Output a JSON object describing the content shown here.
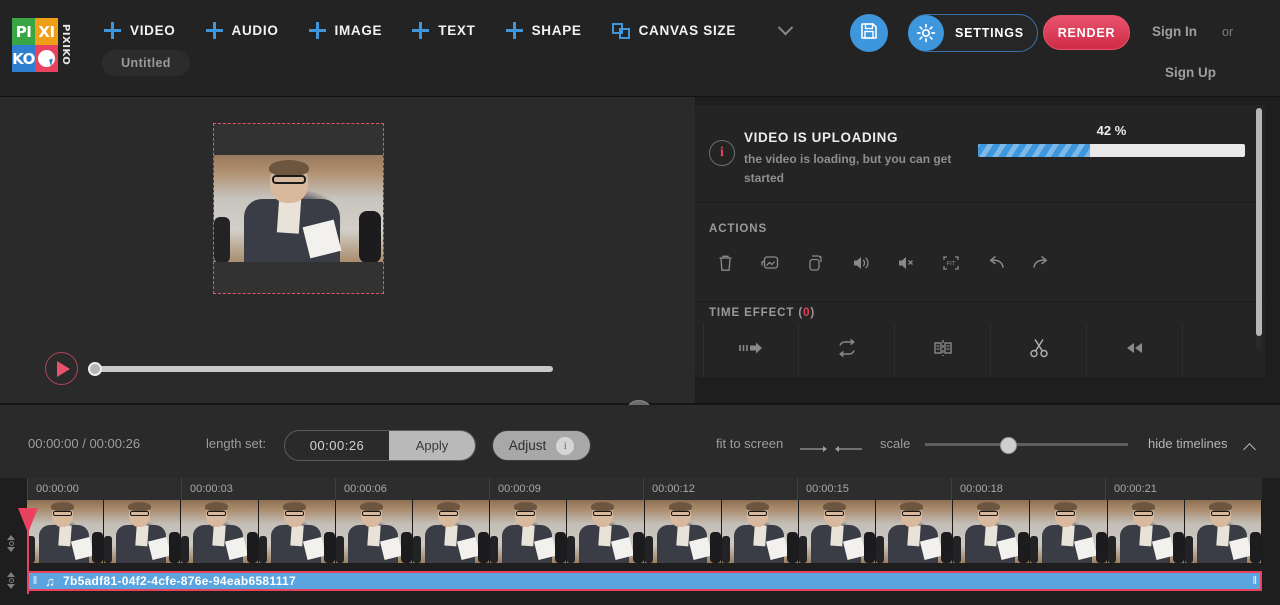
{
  "header": {
    "logo": {
      "cells": [
        "PI",
        "XI",
        "KO",
        ""
      ],
      "vertical_text": "PIXIKO",
      "colors": {
        "pi": "#3aa545",
        "xi": "#f0a018",
        "ko": "#2f7fd0",
        "dot": "#e8425f"
      }
    },
    "menu": [
      {
        "label": "VIDEO",
        "icon": "plus-icon"
      },
      {
        "label": "AUDIO",
        "icon": "plus-icon"
      },
      {
        "label": "IMAGE",
        "icon": "plus-icon"
      },
      {
        "label": "TEXT",
        "icon": "plus-icon"
      },
      {
        "label": "SHAPE",
        "icon": "plus-icon"
      },
      {
        "label": "CANVAS SIZE",
        "icon": "canvas-size-icon"
      }
    ],
    "project_name": "Untitled",
    "save_icon": "floppy-disk-icon",
    "settings_label": "SETTINGS",
    "settings_icon": "gear-icon",
    "render_label": "RENDER",
    "sign_in": "Sign In",
    "or": "or",
    "sign_up": "Sign Up",
    "accent_blue": "#3e96dd",
    "accent_red": "#e8425f"
  },
  "preview": {
    "play_icon": "play-icon",
    "seek_position_pct": 0
  },
  "panel": {
    "upload": {
      "title": "VIDEO IS UPLOADING",
      "subtitle": "the video is loading, but you can get started",
      "percent_label": "42 %",
      "percent_value": 42,
      "info_icon": "info-icon"
    },
    "actions": {
      "title": "ACTIONS",
      "items": [
        {
          "icon": "trash-icon",
          "name": "delete"
        },
        {
          "icon": "image-frame-icon",
          "name": "background"
        },
        {
          "icon": "duplicate-icon",
          "name": "duplicate"
        },
        {
          "icon": "volume-up-icon",
          "name": "volume-up"
        },
        {
          "icon": "volume-mute-icon",
          "name": "mute"
        },
        {
          "icon": "fit-icon",
          "name": "fit"
        },
        {
          "icon": "undo-icon",
          "name": "undo"
        },
        {
          "icon": "redo-icon",
          "name": "redo"
        }
      ]
    },
    "time_effect": {
      "title": "TIME EFFECT (",
      "count": "0",
      "title_end": ")",
      "items": [
        {
          "icon": "speed-icon",
          "name": "speed"
        },
        {
          "icon": "loop-icon",
          "name": "loop"
        },
        {
          "icon": "mirror-icon",
          "name": "mirror"
        },
        {
          "icon": "scissors-icon",
          "name": "cut"
        },
        {
          "icon": "rewind-icon",
          "name": "reverse"
        }
      ]
    }
  },
  "timeline_controls": {
    "timecode": "00:00:00 / 00:00:26",
    "length_set_label": "length set:",
    "length_value": "00:00:26",
    "apply_label": "Apply",
    "adjust_label": "Adjust",
    "adjust_info": "i",
    "fit_to_screen": "fit to screen",
    "scale_label": "scale",
    "scale_value": 41,
    "hide_timelines": "hide timelines"
  },
  "timeline": {
    "ruler_ticks": [
      "00:00:00",
      "00:00:03",
      "00:00:06",
      "00:00:09",
      "00:00:12",
      "00:00:15",
      "00:00:18",
      "00:00:21"
    ],
    "video_frame_count": 16,
    "audio_track": {
      "name": "7b5adf81-04f2-4cfe-876e-94eab6581117",
      "grip": "‖",
      "note_icon": "music-note-icon",
      "color": "#5aa5e0",
      "border_color": "#e8425f"
    }
  }
}
